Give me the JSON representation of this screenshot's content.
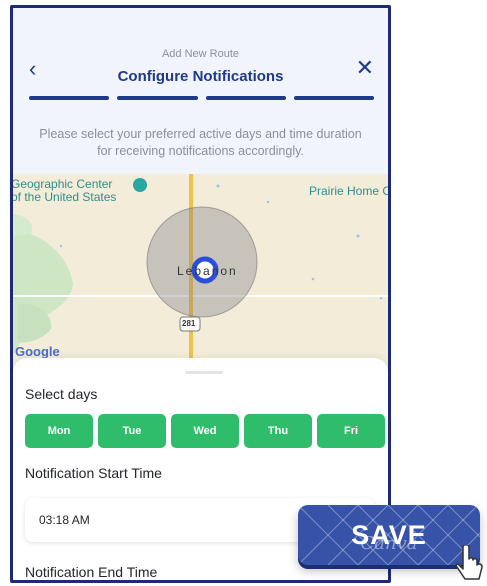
{
  "header": {
    "subtitle": "Add New Route",
    "title": "Configure Notifications",
    "back_icon": "chevron-left",
    "close_icon": "close-x",
    "steps": [
      1,
      2,
      3,
      4
    ],
    "accent_color": "#1e3a8a"
  },
  "description": "Please select your preferred active days and time duration for receiving notifications accordingly.",
  "map": {
    "labels": {
      "geo_center_line1": "Geographic Center",
      "geo_center_line2": "of the United States",
      "prairie": "Prairie Home C",
      "city": "Lebanon",
      "highway": "281",
      "google": "Google"
    }
  },
  "sheet": {
    "select_days_label": "Select days",
    "days": [
      "Mon",
      "Tue",
      "Wed",
      "Thu",
      "Fri"
    ],
    "day_color": "#2fbd6c",
    "start_label": "Notification Start Time",
    "start_value": "03:18 AM",
    "end_label": "Notification End Time"
  },
  "save_button": {
    "label": "SAVE",
    "watermark": "Canva",
    "color": "#3753a8"
  }
}
